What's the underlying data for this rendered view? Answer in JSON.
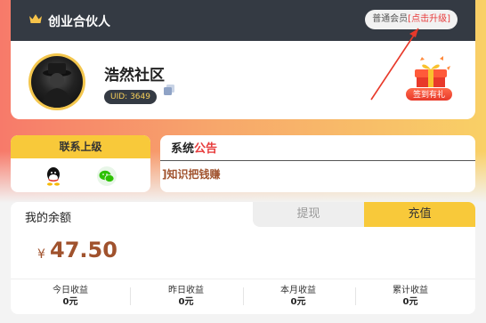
{
  "header": {
    "title": "创业合伙人",
    "member_level": "普通会员",
    "upgrade_link": "[点击升级]"
  },
  "profile": {
    "name": "浩然社区",
    "uid": "UID: 3649",
    "checkin_label": "签到有礼"
  },
  "contact": {
    "title": "联系上级",
    "icons": [
      "qq-icon",
      "wechat-icon"
    ]
  },
  "notice": {
    "title_part1": "系统",
    "title_part2": "公告",
    "text": "]知识把钱赚"
  },
  "balance": {
    "label": "我的余额",
    "currency": "¥",
    "value": "47.50",
    "tab_withdraw": "提现",
    "tab_recharge": "充值"
  },
  "stats": [
    {
      "label": "今日收益",
      "value": "0元"
    },
    {
      "label": "昨日收益",
      "value": "0元"
    },
    {
      "label": "本月收益",
      "value": "0元"
    },
    {
      "label": "累计收益",
      "value": "0元"
    }
  ],
  "colors": {
    "header_dark": "#343a43",
    "accent_yellow": "#f8c93a",
    "accent_red": "#e73c3c",
    "balance_brown": "#a0522d"
  }
}
